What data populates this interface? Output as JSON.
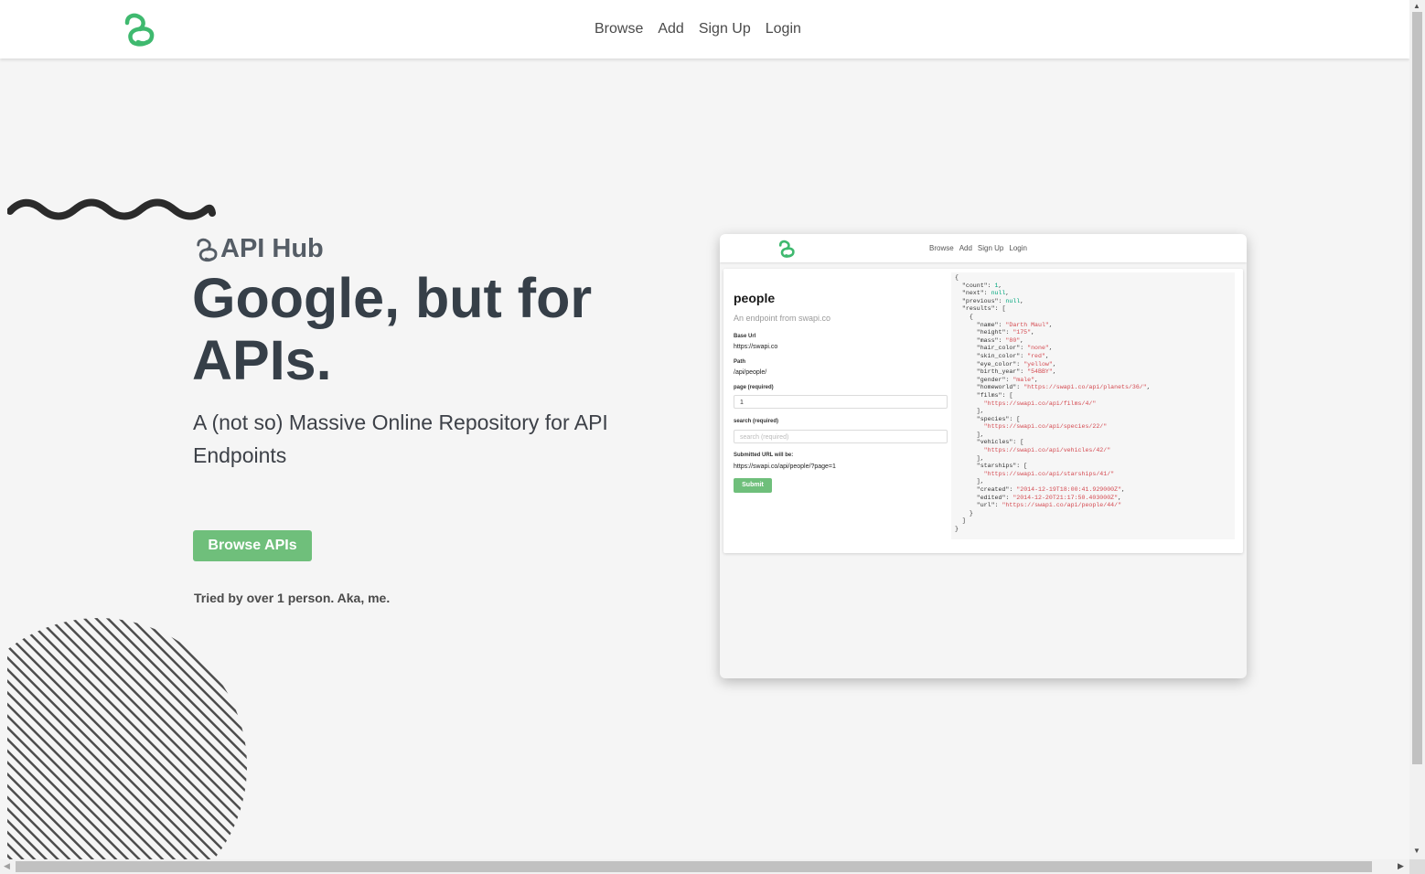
{
  "brand_color": "#3fb96f",
  "accent_color": "#6fbf7b",
  "nav": {
    "logo": "chain-link-logo",
    "links": [
      "Browse",
      "Add",
      "Sign Up",
      "Login"
    ]
  },
  "hero": {
    "brand": "API Hub",
    "title": "Google, but for APIs.",
    "description": "A (not so) Massive Online Repository for API Endpoints",
    "cta": "Browse APIs",
    "tagline": "Tried by over 1 person. Aka, me."
  },
  "preview": {
    "nav_links": [
      "Browse",
      "Add",
      "Sign Up",
      "Login"
    ],
    "endpoint_name": "people",
    "endpoint_desc": "An endpoint from swapi.co",
    "base_url_label": "Base Url",
    "base_url": "https://swapi.co",
    "path_label": "Path",
    "path": "/api/people/",
    "page_label": "page (required)",
    "page_value": "1",
    "search_label": "search (required)",
    "search_placeholder": "search (required)",
    "submitted_label": "Submitted URL will be:",
    "submitted_url": "https://swapi.co/api/people/?page=1",
    "submit": "Submit",
    "json_lines": [
      "{",
      "  \"count\": 1,",
      "  \"next\": null,",
      "  \"previous\": null,",
      "  \"results\": [",
      "    {",
      "      \"name\": \"Darth Maul\",",
      "      \"height\": \"175\",",
      "      \"mass\": \"80\",",
      "      \"hair_color\": \"none\",",
      "      \"skin_color\": \"red\",",
      "      \"eye_color\": \"yellow\",",
      "      \"birth_year\": \"54BBY\",",
      "      \"gender\": \"male\",",
      "      \"homeworld\": \"https://swapi.co/api/planets/36/\",",
      "      \"films\": [",
      "        \"https://swapi.co/api/films/4/\"",
      "      ],",
      "      \"species\": [",
      "        \"https://swapi.co/api/species/22/\"",
      "      ],",
      "      \"vehicles\": [",
      "        \"https://swapi.co/api/vehicles/42/\"",
      "      ],",
      "      \"starships\": [",
      "        \"https://swapi.co/api/starships/41/\"",
      "      ],",
      "      \"created\": \"2014-12-19T18:00:41.929000Z\",",
      "      \"edited\": \"2014-12-20T21:17:50.403000Z\",",
      "      \"url\": \"https://swapi.co/api/people/44/\"",
      "    }",
      "  ]",
      "}"
    ]
  }
}
